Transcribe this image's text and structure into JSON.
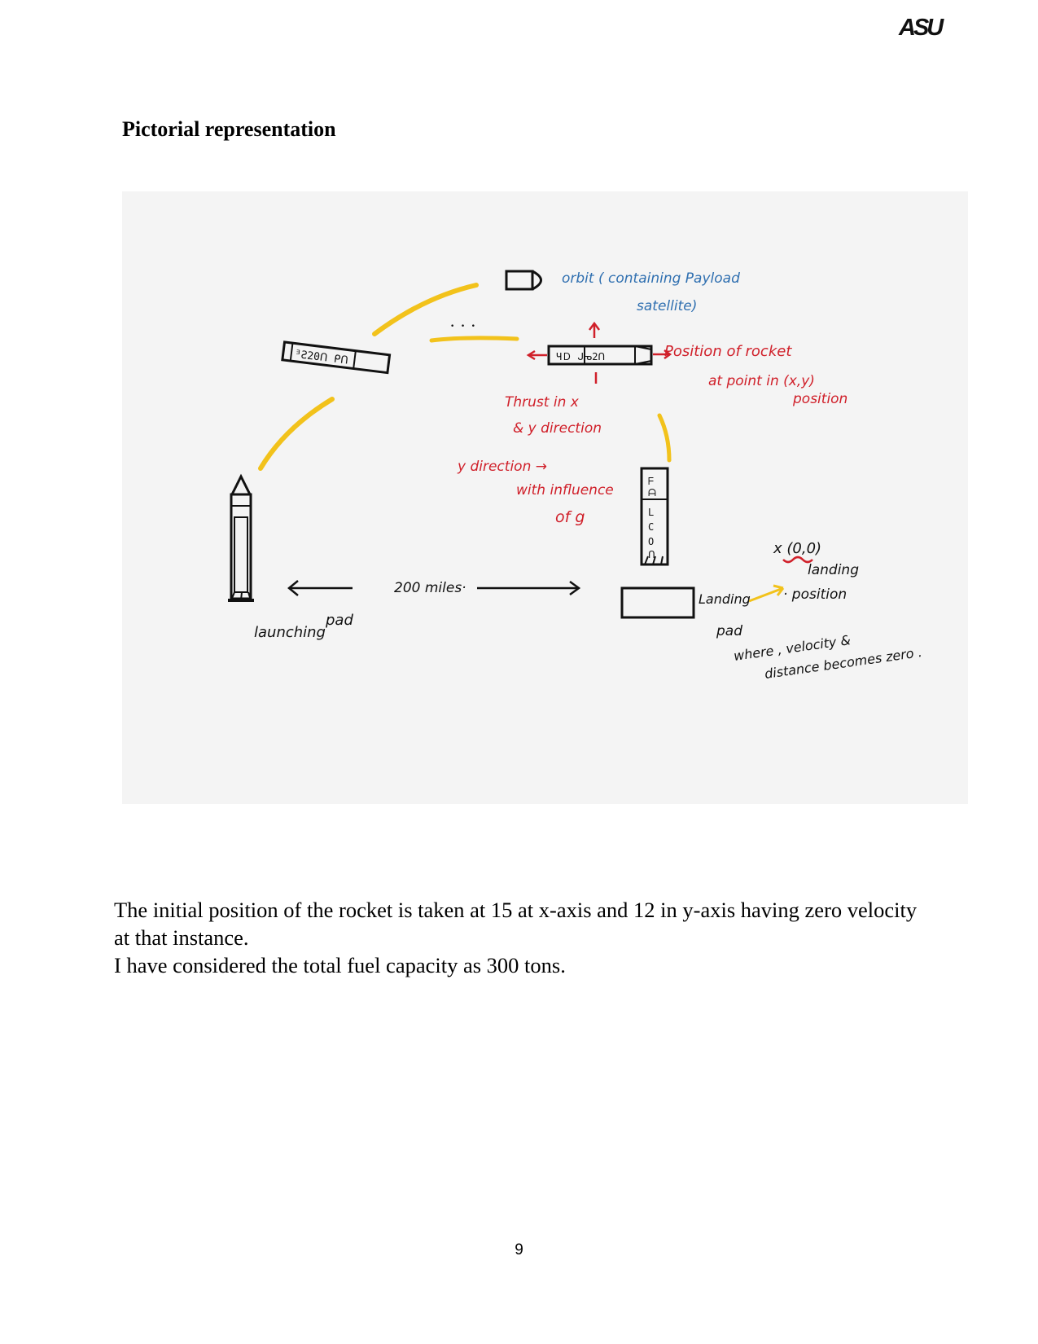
{
  "header": {
    "logo_text": "ASU"
  },
  "section": {
    "heading": "Pictorial representation"
  },
  "sketch": {
    "orbit_label_1": "orbit ( containing Payload",
    "orbit_label_2": "satellite)",
    "position_label_1": "Position of rocket",
    "position_label_2": "at point in (x,y)",
    "position_label_3": "position",
    "thrust_label_1": "Thrust in x",
    "thrust_label_2": "& y direction",
    "ydir_label_1": "y direction →",
    "ydir_label_2": "with influence",
    "ydir_label_3": "of g",
    "distance_label": "200 miles·",
    "launch_label_1": "launching",
    "launch_label_2": "pad",
    "landing_label_1": "Landing",
    "landing_label_2": "pad",
    "coord_label": "x (0,0)",
    "landing_pos_1": "landing",
    "landing_pos_2": "· position",
    "where_label_1": "where , velocity &",
    "where_label_2": "distance becomes zero ."
  },
  "body": {
    "paragraph_1": "The initial position of the rocket is taken at 15 at x-axis and 12 in y-axis having zero velocity at that instance.",
    "paragraph_2": "I have considered the total fuel capacity as 300 tons."
  },
  "footer": {
    "page_number": "9"
  },
  "colors": {
    "ink_black": "#111111",
    "ink_red": "#d0202a",
    "ink_blue": "#2f6fb0",
    "ink_yellow": "#f2c21b"
  }
}
